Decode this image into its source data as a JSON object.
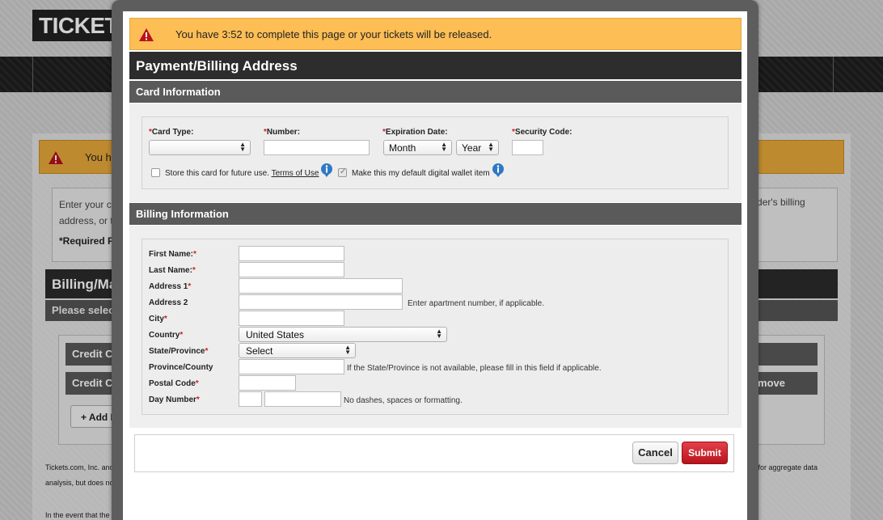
{
  "background": {
    "logo_text": "TICKETS",
    "warning_text": "You hav",
    "info_line1": "Enter your cor",
    "info_line2": "address, or the",
    "info_right": "holder's billing",
    "required_text": "*Required Fiel",
    "header": "Billing/Mail",
    "subheader": "Please select",
    "cc_row1": "Credit Car",
    "cc_row2": "Credit Car",
    "remove_label": "Remove",
    "add_new_label": "+ Add Ne",
    "footer1": "Tickets.com, Inc. and",
    "footer1_right": "n for aggregate data",
    "footer2": "analysis, but does not",
    "footer3": "In the event that the e"
  },
  "modal": {
    "timer_text": "You have 3:52 to complete this page or your tickets will be released.",
    "title": "Payment/Billing Address",
    "card_section": {
      "heading": "Card Information",
      "card_type_label": "Card Type:",
      "card_type_value": "",
      "number_label": "Number:",
      "number_value": "",
      "expiration_label": "Expiration Date:",
      "month_value": "Month",
      "year_value": "Year",
      "security_label": "Security Code:",
      "security_value": "",
      "store_card_text": "Store this card for future use.",
      "terms_link": "Terms of Use",
      "store_card_checked": false,
      "default_wallet_text": "Make this my default digital wallet item",
      "default_wallet_checked": true
    },
    "billing_section": {
      "heading": "Billing Information",
      "first_name_label": "First Name:",
      "last_name_label": "Last Name:",
      "address1_label": "Address 1",
      "address2_label": "Address 2",
      "address2_hint": "Enter apartment number, if applicable.",
      "city_label": "City",
      "country_label": "Country",
      "country_value": "United States",
      "state_label": "State/Province",
      "state_value": "Select",
      "province_label": "Province/County",
      "province_hint": "If the State/Province is not available, please fill in this field if applicable.",
      "postal_label": "Postal Code",
      "day_number_label": "Day Number",
      "day_number_hint": "No dashes, spaces or formatting."
    },
    "buttons": {
      "cancel": "Cancel",
      "submit": "Submit"
    }
  },
  "colors": {
    "timer_bg": "#fcbe55",
    "title_bar": "#2d2d2d",
    "section_bar": "#5a5a5a",
    "required": "#d0202a",
    "submit": "#c9222c"
  }
}
